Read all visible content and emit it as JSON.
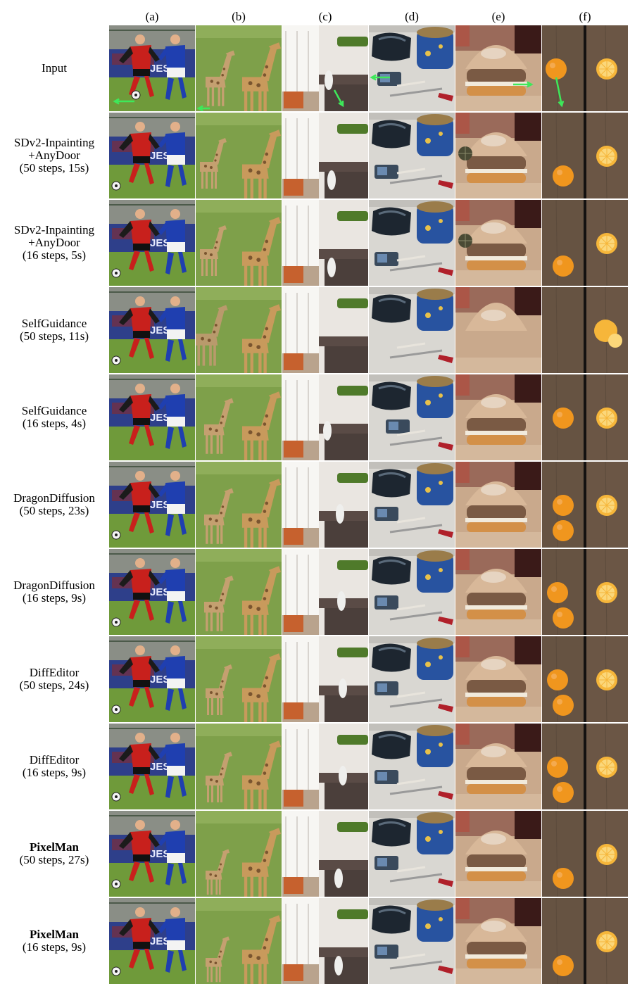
{
  "columns": [
    "(a)",
    "(b)",
    "(c)",
    "(d)",
    "(e)",
    "(f)"
  ],
  "rows": [
    {
      "label_lines": [
        "Input"
      ],
      "bold": false
    },
    {
      "label_lines": [
        "SDv2-Inpainting",
        "+AnyDoor",
        "(50 steps, 15s)"
      ],
      "bold": false
    },
    {
      "label_lines": [
        "SDv2-Inpainting",
        "+AnyDoor",
        "(16 steps, 5s)"
      ],
      "bold": false
    },
    {
      "label_lines": [
        "SelfGuidance",
        "(50 steps, 11s)"
      ],
      "bold": false
    },
    {
      "label_lines": [
        "SelfGuidance",
        "(16 steps, 4s)"
      ],
      "bold": false
    },
    {
      "label_lines": [
        "DragonDiffusion",
        "(50 steps, 23s)"
      ],
      "bold": false
    },
    {
      "label_lines": [
        "DragonDiffusion",
        "(16 steps, 9s)"
      ],
      "bold": false
    },
    {
      "label_lines": [
        "DiffEditor",
        "(50 steps, 24s)"
      ],
      "bold": false
    },
    {
      "label_lines": [
        "DiffEditor",
        "(16 steps, 9s)"
      ],
      "bold": false
    },
    {
      "label_lines": [
        "PixelMan",
        "(50 steps, 27s)"
      ],
      "bold": true
    },
    {
      "label_lines": [
        "PixelMan",
        "(16 steps, 9s)"
      ],
      "bold": true
    }
  ],
  "scenes": [
    "soccer-players",
    "giraffes",
    "living-room",
    "phone-and-teacup",
    "burger",
    "orange-on-wood"
  ],
  "colors": {
    "arrow": "#3ee85a",
    "grass": "#6f9a3a",
    "red_jersey": "#c8201c",
    "blue_jersey": "#1f3fb0",
    "giraffe": "#c89a5c",
    "wood": "#6b5645",
    "orange": "#f0961e",
    "bun": "#d8b899",
    "patty": "#7a5a44"
  }
}
